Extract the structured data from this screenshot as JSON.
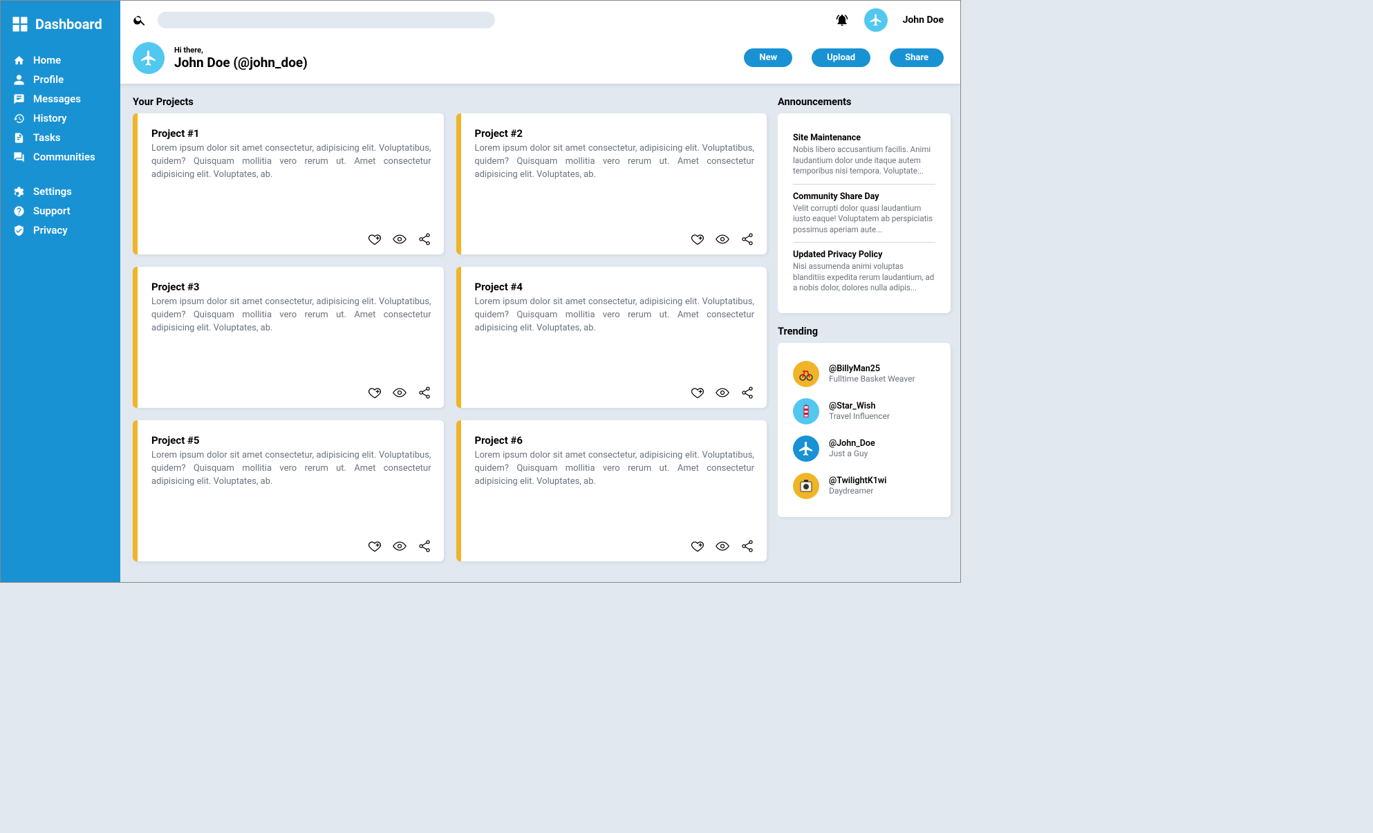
{
  "brand": "Dashboard",
  "nav": {
    "primary": [
      "Home",
      "Profile",
      "Messages",
      "History",
      "Tasks",
      "Communities"
    ],
    "secondary": [
      "Settings",
      "Support",
      "Privacy"
    ]
  },
  "topbar": {
    "username": "John Doe"
  },
  "header": {
    "greeting_small": "Hi there,",
    "greeting_big": "John Doe (@john_doe)",
    "buttons": {
      "new": "New",
      "upload": "Upload",
      "share": "Share"
    }
  },
  "sections": {
    "projects_title": "Your Projects",
    "announcements_title": "Announcements",
    "trending_title": "Trending"
  },
  "projects": [
    {
      "title": "Project #1",
      "desc": "Lorem ipsum dolor sit amet consectetur, adipisicing elit. Voluptatibus, quidem? Quisquam mollitia vero rerum ut. Amet consectetur adipisicing elit. Voluptates, ab."
    },
    {
      "title": "Project #2",
      "desc": "Lorem ipsum dolor sit amet consectetur, adipisicing elit. Voluptatibus, quidem? Quisquam mollitia vero rerum ut. Amet consectetur adipisicing elit. Voluptates, ab."
    },
    {
      "title": "Project #3",
      "desc": "Lorem ipsum dolor sit amet consectetur, adipisicing elit. Voluptatibus, quidem? Quisquam mollitia vero rerum ut. Amet consectetur adipisicing elit. Voluptates, ab."
    },
    {
      "title": "Project #4",
      "desc": "Lorem ipsum dolor sit amet consectetur, adipisicing elit. Voluptatibus, quidem? Quisquam mollitia vero rerum ut. Amet consectetur adipisicing elit. Voluptates, ab."
    },
    {
      "title": "Project #5",
      "desc": "Lorem ipsum dolor sit amet consectetur, adipisicing elit. Voluptatibus, quidem? Quisquam mollitia vero rerum ut. Amet consectetur adipisicing elit. Voluptates, ab."
    },
    {
      "title": "Project #6",
      "desc": "Lorem ipsum dolor sit amet consectetur, adipisicing elit. Voluptatibus, quidem? Quisquam mollitia vero rerum ut. Amet consectetur adipisicing elit. Voluptates, ab."
    }
  ],
  "announcements": [
    {
      "title": "Site Maintenance",
      "body": "Nobis libero accusantium facilis. Animi laudantium dolor unde itaque autem temporibus nisi tempora. Voluptate..."
    },
    {
      "title": "Community Share Day",
      "body": "Velit corrupti dolor quasi laudantium iusto eaque! Voluptatem ab perspiciatis possimus aperiam aute..."
    },
    {
      "title": "Updated Privacy Policy",
      "body": "Nisi assumenda animi voluptas blanditiis expedita rerum laudantium, ad a nobis dolor, dolores nulla adipis..."
    }
  ],
  "trending": [
    {
      "handle": "@BillyMan25",
      "role": "Fulltime Basket Weaver",
      "color": "#f0b429"
    },
    {
      "handle": "@Star_Wish",
      "role": "Travel Influencer",
      "color": "#52c7ef"
    },
    {
      "handle": "@John_Doe",
      "role": "Just a Guy",
      "color": "#1992d4"
    },
    {
      "handle": "@TwilightK1wi",
      "role": "Daydreamer",
      "color": "#f0b429"
    }
  ]
}
